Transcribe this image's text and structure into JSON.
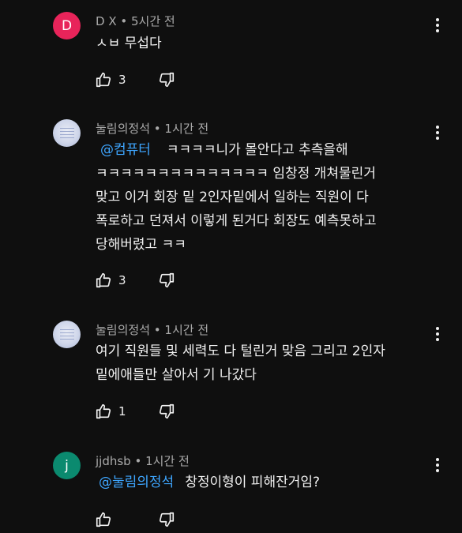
{
  "comments": [
    {
      "avatar_letter": "D",
      "avatar_color": "#e8245a",
      "author": "D X",
      "time": "5시간 전",
      "mention": "",
      "text": "ㅅㅂ 무섭다",
      "likes": "3"
    },
    {
      "avatar_letter": "",
      "author": "눌림의정석",
      "time": "1시간 전",
      "mention": "@컴퓨터",
      "text": "ㅋㅋㅋㅋ니가 몰안다고 추측을해\nㅋㅋㅋㅋㅋㅋㅋㅋㅋㅋㅋㅋㅋㅋ 임창정 개쳐물린거\n맞고 이거 회장 밑 2인자밑에서 일하는 직원이 다\n폭로하고 던져서 이렇게 된거다 회장도 예측못하고\n당해버렸고 ㅋㅋ",
      "likes": "3"
    },
    {
      "avatar_letter": "",
      "author": "눌림의정석",
      "time": "1시간 전",
      "mention": "",
      "text": "여기 직원들 및 세력도 다 털린거 맞음 그리고 2인자\n밑에애들만 살아서 기 나갔다",
      "likes": "1"
    },
    {
      "avatar_letter": "j",
      "avatar_color": "#0b8a6f",
      "author": "jjdhsb",
      "time": "1시간 전",
      "mention": "@눌림의정석",
      "text": "창정이형이 피해잔거임?",
      "likes": ""
    }
  ]
}
